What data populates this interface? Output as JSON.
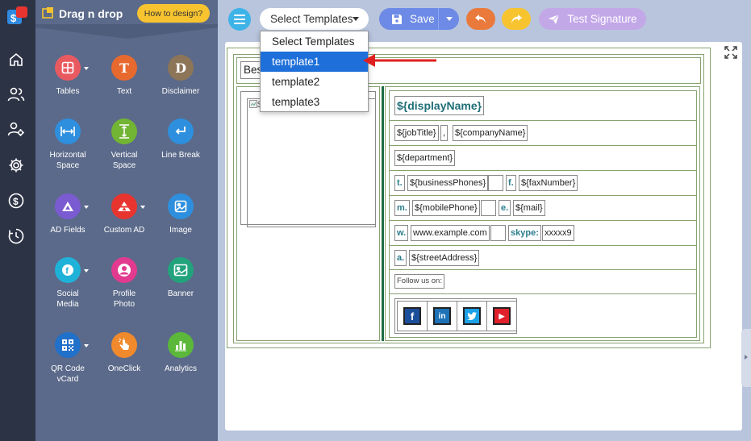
{
  "panel": {
    "title": "Drag n drop",
    "howto_label": "How to design?"
  },
  "tools": [
    {
      "label": "Tables",
      "icon": "table-icon",
      "color": "#e85a60",
      "caret": true
    },
    {
      "label": "Text",
      "icon": "text-icon",
      "color": "#e8692e",
      "glyph": "T"
    },
    {
      "label": "Disclaimer",
      "icon": "disclaimer-icon",
      "color": "#8d7558",
      "glyph": "D"
    },
    {
      "label": "Horizontal\nSpace",
      "icon": "horizontal-space-icon",
      "color": "#2e8fde"
    },
    {
      "label": "Vertical\nSpace",
      "icon": "vertical-space-icon",
      "color": "#72b534"
    },
    {
      "label": "Line Break",
      "icon": "line-break-icon",
      "color": "#2e8fde"
    },
    {
      "label": "AD Fields",
      "icon": "ad-fields-icon",
      "color": "#7b5bd1",
      "caret": true
    },
    {
      "label": "Custom AD",
      "icon": "custom-ad-icon",
      "color": "#e8342e",
      "caret": true
    },
    {
      "label": "Image",
      "icon": "image-icon",
      "color": "#2e8fde"
    },
    {
      "label": "Social\nMedia",
      "icon": "social-media-icon",
      "color": "#1fb2d9",
      "caret": true
    },
    {
      "label": "Profile\nPhoto",
      "icon": "profile-photo-icon",
      "color": "#e23a8e"
    },
    {
      "label": "Banner",
      "icon": "banner-icon",
      "color": "#23a37c"
    },
    {
      "label": "QR Code\nvCard",
      "icon": "qr-code-icon",
      "color": "#2170c9",
      "caret": true
    },
    {
      "label": "OneClick",
      "icon": "oneclick-icon",
      "color": "#f08a2c"
    },
    {
      "label": "Analytics",
      "icon": "analytics-icon",
      "color": "#5bb83a"
    }
  ],
  "toolbar": {
    "select_label": "Select Templates",
    "save_label": "Save",
    "test_label": "Test Signature"
  },
  "dropdown": {
    "options": [
      "Select Templates",
      "template1",
      "template2",
      "template3"
    ],
    "selected": "template1"
  },
  "signature": {
    "best_text": "Bes",
    "image_alt": "$",
    "display_name": "${displayName}",
    "job_title": "${jobTitle}",
    "comma": ",",
    "company_name": "${companyName}",
    "department": "${department}",
    "t_label": "t.",
    "business_phones": "${businessPhones}",
    "f_label": "f.",
    "fax_number": "${faxNumber}",
    "m_label": "m.",
    "mobile_phone": "${mobilePhone}",
    "e_label": "e.",
    "mail": "${mail}",
    "w_label": "w.",
    "website": "www.example.com",
    "skype_label": "skype:",
    "skype_value": "xxxxx9",
    "a_label": "a.",
    "street_address": "${streetAddress}",
    "follow_us": "Follow us on:",
    "social": [
      {
        "name": "facebook",
        "glyph": "f",
        "color": "#1b4f9b"
      },
      {
        "name": "linkedin",
        "glyph": "in",
        "color": "#1d72b8"
      },
      {
        "name": "twitter",
        "glyph": "t",
        "color": "#1da1e6"
      },
      {
        "name": "youtube",
        "glyph": "▶",
        "color": "#e0202a"
      }
    ]
  }
}
